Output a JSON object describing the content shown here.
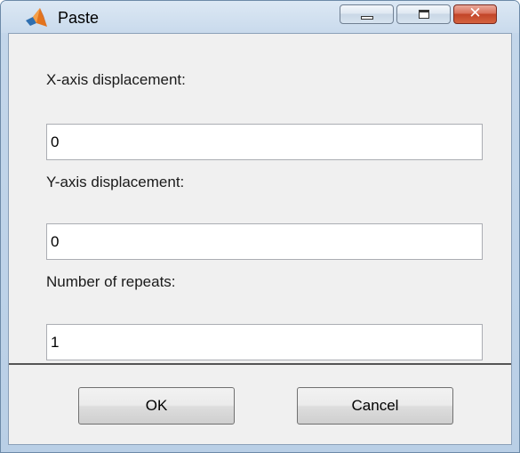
{
  "window": {
    "title": "Paste",
    "icon": "matlab-icon",
    "controls": {
      "minimize_icon": "minimize-icon",
      "maximize_icon": "maximize-icon",
      "close_icon": "close-icon",
      "close_glyph": "✕"
    }
  },
  "form": {
    "fields": [
      {
        "label": "X-axis displacement:",
        "value": "0"
      },
      {
        "label": "Y-axis displacement:",
        "value": "0"
      },
      {
        "label": "Number of repeats:",
        "value": "1"
      }
    ]
  },
  "buttons": {
    "ok_label": "OK",
    "cancel_label": "Cancel"
  },
  "colors": {
    "titlebar": "#c9daec",
    "close_button": "#c24528",
    "client_background": "#f0f0f0"
  }
}
